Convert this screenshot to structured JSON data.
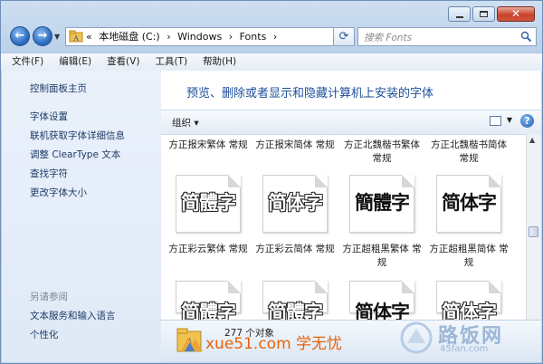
{
  "window": {
    "address": {
      "prefix": "«",
      "crumbs": [
        "本地磁盘 (C:)",
        "›",
        "Windows",
        "›",
        "Fonts",
        "›"
      ]
    },
    "search": {
      "placeholder": "搜索 Fonts"
    }
  },
  "menu": [
    "文件(F)",
    "编辑(E)",
    "查看(V)",
    "工具(T)",
    "帮助(H)"
  ],
  "left_pane": {
    "home": "控制面板主页",
    "links": [
      "字体设置",
      "联机获取字体详细信息",
      "调整 ClearType 文本",
      "查找字符",
      "更改字体大小"
    ],
    "see_also": "另请参阅",
    "see_also_links": [
      "文本服务和输入语言",
      "个性化"
    ]
  },
  "main": {
    "heading": "预览、删除或者显示和隐藏计算机上安装的字体",
    "organize": "组织 ▾",
    "fonts_row1": [
      {
        "name": "方正报宋繁体 常规",
        "sample": "简體字",
        "style": "outline"
      },
      {
        "name": "方正报宋简体 常规",
        "sample": "简体字",
        "style": "outline"
      },
      {
        "name": "方正北魏楷书繁体 常规",
        "sample": "簡體字",
        "style": "solid"
      },
      {
        "name": "方正北魏楷书简体 常规",
        "sample": "简体字",
        "style": "solid"
      }
    ],
    "fonts_row2": [
      {
        "name": "方正彩云繁体 常规",
        "sample": "简體字",
        "style": "outline"
      },
      {
        "name": "方正彩云简体 常规",
        "sample": "简體字",
        "style": "outline"
      },
      {
        "name": "方正超粗黑繁体 常规",
        "sample": "简体字",
        "style": "solid"
      },
      {
        "name": "方正超粗黑简体 常规",
        "sample": "简体字",
        "style": "outline"
      }
    ]
  },
  "status": {
    "count": "277 个对象"
  },
  "watermark_left": "xue51.com 学无忧",
  "watermark_right": {
    "big": "路饭网",
    "small": "45fan.com"
  }
}
